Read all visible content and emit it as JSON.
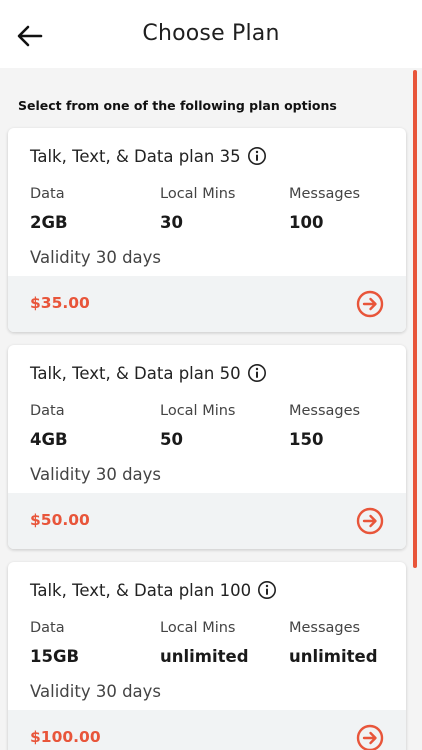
{
  "header": {
    "title": "Choose Plan",
    "back_icon": "arrow-left-icon"
  },
  "intro_text": "Select from one of the following plan options",
  "colors": {
    "accent": "#e8553a",
    "background": "#f4f4f4",
    "card_footer": "#f1f3f4"
  },
  "plans": [
    {
      "name": "Talk, Text, & Data plan 35",
      "columns": [
        {
          "label": "Data",
          "value": "2GB"
        },
        {
          "label": "Local Mins",
          "value": "30"
        },
        {
          "label": "Messages",
          "value": "100"
        }
      ],
      "validity": "Validity 30 days",
      "price": "$35.00"
    },
    {
      "name": "Talk, Text, & Data plan 50",
      "columns": [
        {
          "label": "Data",
          "value": "4GB"
        },
        {
          "label": "Local Mins",
          "value": "50"
        },
        {
          "label": "Messages",
          "value": "150"
        }
      ],
      "validity": "Validity 30 days",
      "price": "$50.00"
    },
    {
      "name": "Talk, Text, & Data plan 100",
      "columns": [
        {
          "label": "Data",
          "value": "15GB"
        },
        {
          "label": "Local Mins",
          "value": "unlimited"
        },
        {
          "label": "Messages",
          "value": "unlimited"
        }
      ],
      "validity": "Validity 30 days",
      "price": "$100.00"
    }
  ]
}
